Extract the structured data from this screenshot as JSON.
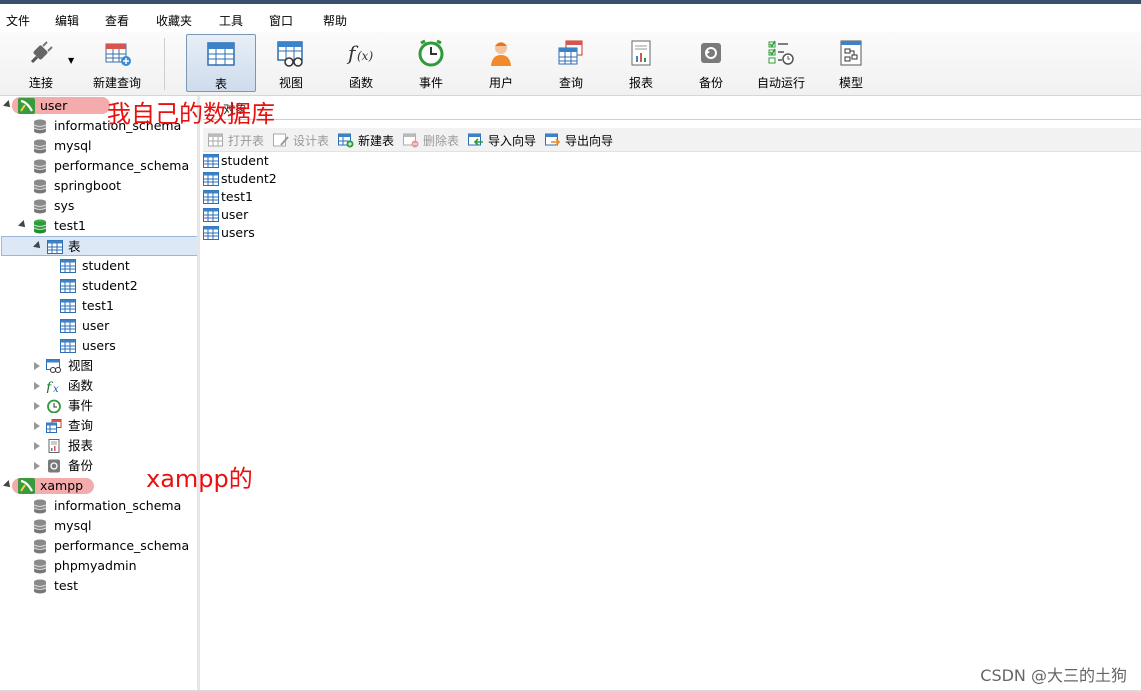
{
  "menu": [
    "文件",
    "编辑",
    "查看",
    "收藏夹",
    "工具",
    "窗口",
    "帮助"
  ],
  "toolbar": {
    "buttons": [
      {
        "id": "connect",
        "label": "连接",
        "icon": "connect-plug-icon"
      },
      {
        "id": "newquery",
        "label": "新建查询",
        "icon": "new-query-icon"
      },
      {
        "id": "table",
        "label": "表",
        "icon": "table-icon",
        "active": true
      },
      {
        "id": "view",
        "label": "视图",
        "icon": "view-icon"
      },
      {
        "id": "function",
        "label": "函数",
        "icon": "function-icon"
      },
      {
        "id": "event",
        "label": "事件",
        "icon": "event-clock-icon"
      },
      {
        "id": "user",
        "label": "用户",
        "icon": "user-icon"
      },
      {
        "id": "query",
        "label": "查询",
        "icon": "query-icon"
      },
      {
        "id": "report",
        "label": "报表",
        "icon": "report-icon"
      },
      {
        "id": "backup",
        "label": "备份",
        "icon": "backup-icon"
      },
      {
        "id": "autorun",
        "label": "自动运行",
        "icon": "autorun-icon"
      },
      {
        "id": "model",
        "label": "模型",
        "icon": "model-icon"
      }
    ]
  },
  "tree": {
    "conn1": {
      "label": "user"
    },
    "conn1_dbs": [
      "information_schema",
      "mysql",
      "performance_schema",
      "springboot",
      "sys",
      "test1"
    ],
    "tables_folder": "表",
    "tables": [
      "student",
      "student2",
      "test1",
      "user",
      "users"
    ],
    "folders": [
      {
        "label": "视图",
        "icon": "view-icon"
      },
      {
        "label": "函数",
        "icon": "function-icon"
      },
      {
        "label": "事件",
        "icon": "event-clock-icon"
      },
      {
        "label": "查询",
        "icon": "query-icon"
      },
      {
        "label": "报表",
        "icon": "report-icon"
      },
      {
        "label": "备份",
        "icon": "backup-icon"
      }
    ],
    "conn2": {
      "label": "xampp"
    },
    "conn2_dbs": [
      "information_schema",
      "mysql",
      "performance_schema",
      "phpmyadmin",
      "test"
    ]
  },
  "annotations": {
    "own_db": "我自己的数据库",
    "xampp": "xampp的"
  },
  "main": {
    "tab_label": "对象",
    "actions": [
      {
        "label": "打开表",
        "enabled": false
      },
      {
        "label": "设计表",
        "enabled": false
      },
      {
        "label": "新建表",
        "enabled": true
      },
      {
        "label": "删除表",
        "enabled": false
      },
      {
        "label": "导入向导",
        "enabled": true
      },
      {
        "label": "导出向导",
        "enabled": true
      }
    ],
    "objects": [
      "student",
      "student2",
      "test1",
      "user",
      "users"
    ]
  },
  "watermark": "CSDN @大三的土狗",
  "colors": {
    "annotation": "#e8110f",
    "highlight": "#f19c9c",
    "selected": "#dce8f6"
  }
}
